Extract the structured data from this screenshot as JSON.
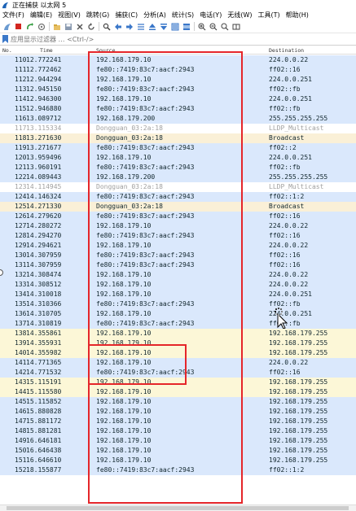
{
  "window": {
    "title": "正在捕获 以太网 5"
  },
  "menu": [
    "文件(F)",
    "编辑(E)",
    "视图(V)",
    "跳转(G)",
    "捕获(C)",
    "分析(A)",
    "统计(S)",
    "电话(Y)",
    "无线(W)",
    "工具(T)",
    "帮助(H)"
  ],
  "filter": {
    "placeholder": "应用显示过滤器 … <Ctrl-/>"
  },
  "columns": {
    "no": "No.",
    "time": "Time",
    "source": "Source",
    "destination": "Destination"
  },
  "colors": {
    "udp_row": "#dae8fc",
    "arp_row": "#faf0d7",
    "highlight": "#e5262a"
  },
  "packets": [
    {
      "no": "110",
      "time": "12.772241",
      "source": "192.168.179.10",
      "destination": "224.0.0.22",
      "color": "#dae8fc"
    },
    {
      "no": "111",
      "time": "12.772462",
      "source": "fe80::7419:83c7:aacf:2943",
      "destination": "ff02::16",
      "color": "#dae8fc"
    },
    {
      "no": "112",
      "time": "12.944294",
      "source": "192.168.179.10",
      "destination": "224.0.0.251",
      "color": "#dae8fc"
    },
    {
      "no": "113",
      "time": "12.945150",
      "source": "fe80::7419:83c7:aacf:2943",
      "destination": "ff02::fb",
      "color": "#dae8fc"
    },
    {
      "no": "114",
      "time": "12.946300",
      "source": "192.168.179.10",
      "destination": "224.0.0.251",
      "color": "#dae8fc"
    },
    {
      "no": "115",
      "time": "12.946880",
      "source": "fe80::7419:83c7:aacf:2943",
      "destination": "ff02::fb",
      "color": "#dae8fc"
    },
    {
      "no": "116",
      "time": "13.089712",
      "source": "192.168.179.200",
      "destination": "255.255.255.255",
      "color": "#dae8fc"
    },
    {
      "no": "117",
      "time": "13.115334",
      "source": "Dongguan_03:2a:18",
      "destination": "LLDP_Multicast",
      "color": "#ffffff",
      "grey": true
    },
    {
      "no": "118",
      "time": "13.271630",
      "source": "Dongguan_03:2a:18",
      "destination": "Broadcast",
      "color": "#faf0d7"
    },
    {
      "no": "119",
      "time": "13.271677",
      "source": "fe80::7419:83c7:aacf:2943",
      "destination": "ff02::2",
      "color": "#dae8fc"
    },
    {
      "no": "120",
      "time": "13.959496",
      "source": "192.168.179.10",
      "destination": "224.0.0.251",
      "color": "#dae8fc"
    },
    {
      "no": "121",
      "time": "13.960191",
      "source": "fe80::7419:83c7:aacf:2943",
      "destination": "ff02::fb",
      "color": "#dae8fc"
    },
    {
      "no": "122",
      "time": "14.089443",
      "source": "192.168.179.200",
      "destination": "255.255.255.255",
      "color": "#dae8fc"
    },
    {
      "no": "123",
      "time": "14.114945",
      "source": "Dongguan_03:2a:18",
      "destination": "LLDP_Multicast",
      "color": "#ffffff",
      "grey": true
    },
    {
      "no": "124",
      "time": "14.146324",
      "source": "fe80::7419:83c7:aacf:2943",
      "destination": "ff02::1:2",
      "color": "#dae8fc"
    },
    {
      "no": "125",
      "time": "14.271330",
      "source": "Dongguan_03:2a:18",
      "destination": "Broadcast",
      "color": "#faf0d7"
    },
    {
      "no": "126",
      "time": "14.279620",
      "source": "fe80::7419:83c7:aacf:2943",
      "destination": "ff02::16",
      "color": "#dae8fc"
    },
    {
      "no": "127",
      "time": "14.280272",
      "source": "192.168.179.10",
      "destination": "224.0.0.22",
      "color": "#dae8fc"
    },
    {
      "no": "128",
      "time": "14.294270",
      "source": "fe80::7419:83c7:aacf:2943",
      "destination": "ff02::16",
      "color": "#dae8fc"
    },
    {
      "no": "129",
      "time": "14.294621",
      "source": "192.168.179.10",
      "destination": "224.0.0.22",
      "color": "#dae8fc"
    },
    {
      "no": "130",
      "time": "14.307959",
      "source": "fe80::7419:83c7:aacf:2943",
      "destination": "ff02::16",
      "color": "#dae8fc"
    },
    {
      "no": "131",
      "time": "14.307959",
      "source": "fe80::7419:83c7:aacf:2943",
      "destination": "ff02::16",
      "color": "#dae8fc"
    },
    {
      "no": "132",
      "time": "14.308474",
      "source": "192.168.179.10",
      "destination": "224.0.0.22",
      "color": "#dae8fc"
    },
    {
      "no": "133",
      "time": "14.308512",
      "source": "192.168.179.10",
      "destination": "224.0.0.22",
      "color": "#dae8fc"
    },
    {
      "no": "134",
      "time": "14.310018",
      "source": "192.168.179.10",
      "destination": "224.0.0.251",
      "color": "#dae8fc"
    },
    {
      "no": "135",
      "time": "14.310366",
      "source": "fe80::7419:83c7:aacf:2943",
      "destination": "ff02::fb",
      "color": "#dae8fc"
    },
    {
      "no": "136",
      "time": "14.310705",
      "source": "192.168.179.10",
      "destination": "224.0.0.251",
      "color": "#dae8fc"
    },
    {
      "no": "137",
      "time": "14.310819",
      "source": "fe80::7419:83c7:aacf:2943",
      "destination": "ff02::fb",
      "color": "#dae8fc"
    },
    {
      "no": "138",
      "time": "14.355861",
      "source": "192.168.179.10",
      "destination": "192.168.179.255",
      "color": "#fcf7d7"
    },
    {
      "no": "139",
      "time": "14.355931",
      "source": "192.168.179.10",
      "destination": "192.168.179.255",
      "color": "#fcf7d7"
    },
    {
      "no": "140",
      "time": "14.355982",
      "source": "192.168.179.10",
      "destination": "192.168.179.255",
      "color": "#fcf7d7"
    },
    {
      "no": "141",
      "time": "14.771365",
      "source": "192.168.179.10",
      "destination": "224.0.0.22",
      "color": "#dae8fc"
    },
    {
      "no": "142",
      "time": "14.771532",
      "source": "fe80::7419:83c7:aacf:2943",
      "destination": "ff02::16",
      "color": "#dae8fc"
    },
    {
      "no": "143",
      "time": "15.115191",
      "source": "192.168.179.10",
      "destination": "192.168.179.255",
      "color": "#fcf7d7"
    },
    {
      "no": "144",
      "time": "15.115580",
      "source": "192.168.179.10",
      "destination": "192.168.179.255",
      "color": "#fcf7d7"
    },
    {
      "no": "145",
      "time": "15.115852",
      "source": "192.168.179.10",
      "destination": "192.168.179.255",
      "color": "#dae8fc"
    },
    {
      "no": "146",
      "time": "15.880828",
      "source": "192.168.179.10",
      "destination": "192.168.179.255",
      "color": "#dae8fc"
    },
    {
      "no": "147",
      "time": "15.881172",
      "source": "192.168.179.10",
      "destination": "192.168.179.255",
      "color": "#dae8fc"
    },
    {
      "no": "148",
      "time": "15.881281",
      "source": "192.168.179.10",
      "destination": "192.168.179.255",
      "color": "#dae8fc"
    },
    {
      "no": "149",
      "time": "16.646181",
      "source": "192.168.179.10",
      "destination": "192.168.179.255",
      "color": "#dae8fc"
    },
    {
      "no": "150",
      "time": "16.646438",
      "source": "192.168.179.10",
      "destination": "192.168.179.255",
      "color": "#dae8fc"
    },
    {
      "no": "151",
      "time": "16.646610",
      "source": "192.168.179.10",
      "destination": "192.168.179.255",
      "color": "#dae8fc"
    },
    {
      "no": "152",
      "time": "18.155877",
      "source": "fe80::7419:83c7:aacf:2943",
      "destination": "ff02::1:2",
      "color": "#dae8fc"
    }
  ]
}
